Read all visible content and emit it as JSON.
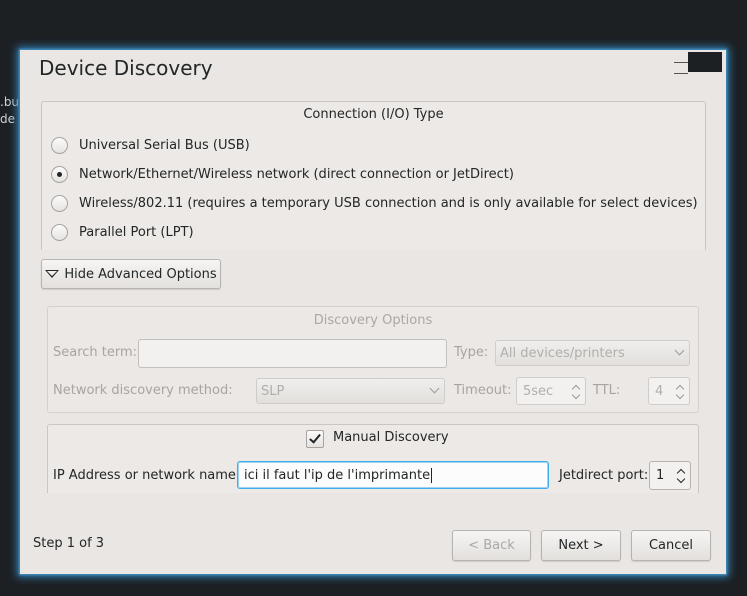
{
  "background": {
    "fragments": [
      ".bu",
      "de"
    ]
  },
  "dialog": {
    "title": "Device Discovery",
    "step": "Step 1 of 3"
  },
  "connection": {
    "title": "Connection (I/O) Type",
    "options": [
      {
        "label": "Universal Serial Bus (USB)",
        "selected": false
      },
      {
        "label": "Network/Ethernet/Wireless network (direct connection or JetDirect)",
        "selected": true
      },
      {
        "label": "Wireless/802.11 (requires a temporary USB connection and is only available for select devices)",
        "selected": false
      },
      {
        "label": "Parallel Port (LPT)",
        "selected": false
      }
    ]
  },
  "advanced_toggle": "Hide Advanced Options",
  "discovery": {
    "title": "Discovery Options",
    "search_label": "Search term:",
    "search_value": "",
    "type_label": "Type:",
    "type_value": "All devices/printers",
    "method_label": "Network discovery method:",
    "method_value": "SLP",
    "timeout_label": "Timeout:",
    "timeout_value": "5sec",
    "ttl_label": "TTL:",
    "ttl_value": "4"
  },
  "manual": {
    "checkbox_label": "Manual Discovery",
    "checked": true,
    "ip_label": "IP Address or network name:",
    "ip_value": "ici il faut l'ip de l'imprimante",
    "port_label": "Jetdirect port:",
    "port_value": "1"
  },
  "buttons": {
    "back": "< Back",
    "next": "Next >",
    "cancel": "Cancel"
  },
  "colors": {
    "window_bg": "#e9e6e3",
    "focus_accent": "#3daee9",
    "glow": "#2f7fb3"
  }
}
